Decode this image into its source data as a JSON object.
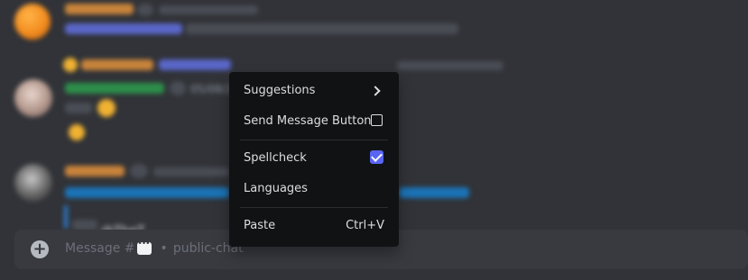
{
  "background_chat": {
    "timestamp_fragment": "05/08/2",
    "reference_fragment": "@TheT"
  },
  "composer": {
    "placeholder_prefix": "Message #",
    "separator": "•",
    "channel": "public-chat",
    "plus_icon": "plus-circle-icon",
    "channel_icon": "speech-bubble-icon"
  },
  "context_menu": {
    "items": [
      {
        "label": "Suggestions",
        "right": "chevron-right-icon"
      },
      {
        "label": "Send Message Button",
        "right": "checkbox-unchecked"
      },
      {
        "label": "Spellcheck",
        "right": "checkbox-checked"
      },
      {
        "label": "Languages"
      },
      {
        "label": "Paste",
        "shortcut": "Ctrl+V"
      }
    ],
    "check_color": "#5865f2"
  }
}
